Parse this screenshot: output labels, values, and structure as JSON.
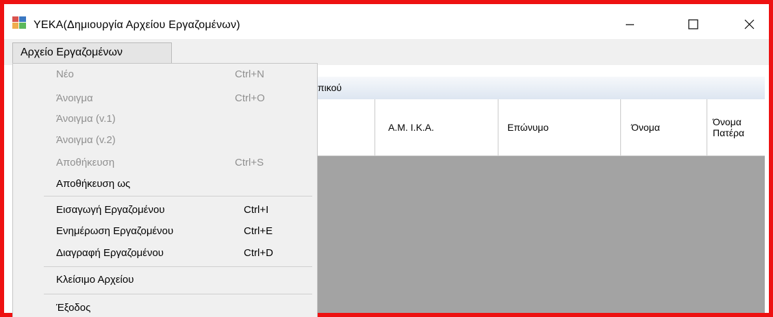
{
  "window": {
    "title": "ΥΕΚΑ(Δημιουργία Αρχείου Εργαζομένων)",
    "app_icon": "app-window-icon",
    "controls": [
      "minimize-icon",
      "maximize-icon",
      "close-icon"
    ]
  },
  "menubar": {
    "root_label": "Αρχείο Εργαζομένων"
  },
  "dropdown": {
    "items": [
      {
        "label": "Νέο",
        "shortcut": "Ctrl+N",
        "enabled": false
      },
      {
        "label": "Άνοιγμα",
        "shortcut": "Ctrl+O",
        "enabled": false
      },
      {
        "label": "Άνοιγμα (v.1)",
        "shortcut": "",
        "enabled": false
      },
      {
        "label": "Άνοιγμα (v.2)",
        "shortcut": "",
        "enabled": false
      },
      {
        "label": "Αποθήκευση",
        "shortcut": "Ctrl+S",
        "enabled": false
      },
      {
        "label": "Αποθήκευση ως",
        "shortcut": "",
        "enabled": true
      },
      {
        "label": "Εισαγωγή Εργαζομένου",
        "shortcut": "Ctrl+I",
        "enabled": true
      },
      {
        "label": "Ενημέρωση Εργαζομένου",
        "shortcut": "Ctrl+E",
        "enabled": true
      },
      {
        "label": "Διαγραφή Εργαζομένου",
        "shortcut": "Ctrl+D",
        "enabled": true
      },
      {
        "label": "Κλείσιμο Αρχείου",
        "shortcut": "",
        "enabled": true
      },
      {
        "label": "Έξοδος",
        "shortcut": "",
        "enabled": true
      }
    ]
  },
  "tab": {
    "label_visible": "πικού"
  },
  "table": {
    "columns": [
      "A.M. I.K.A.",
      "Επώνυμο",
      "Όνομα",
      "Όνομα Πατέρα"
    ]
  },
  "colors": {
    "frame_border": "#ee1111",
    "grid_background": "#a3a3a3",
    "menu_background": "#f0f0f0",
    "disabled_text": "#8f8f8f"
  }
}
